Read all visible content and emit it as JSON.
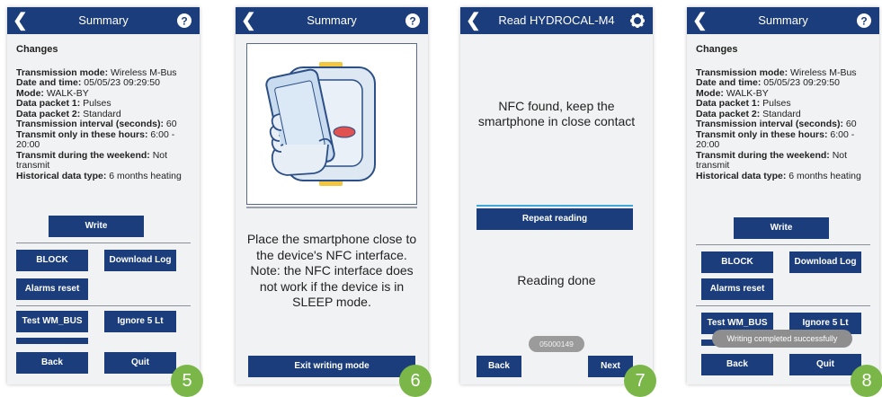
{
  "screens": [
    {
      "title": "Summary",
      "changes_heading": "Changes",
      "fields": [
        {
          "label": "Transmission mode:",
          "value": " Wireless M-Bus"
        },
        {
          "label": "Date and time:",
          "value": " 05/05/23 09:29:50"
        },
        {
          "label": "Mode:",
          "value": " WALK-BY"
        },
        {
          "label": "Data packet 1:",
          "value": " Pulses"
        },
        {
          "label": "Data packet 2:",
          "value": " Standard"
        },
        {
          "label": "Transmission interval (seconds):",
          "value": " 60"
        },
        {
          "label": "Transmit only in these hours:",
          "value": " 6:00 - 20:00"
        },
        {
          "label": "Transmit during the weekend:",
          "value": " Not transmit"
        },
        {
          "label": "Historical data type:",
          "value": " 6 months heating"
        }
      ],
      "write_label": "Write",
      "block_label": "BLOCK",
      "download_log_label": "Download Log",
      "alarms_reset_label": "Alarms reset",
      "test_wm_bus_label": "Test WM_BUS",
      "ignore_label": "Ignore 5 Lt",
      "back_label": "Back",
      "quit_label": "Quit",
      "step": "5"
    },
    {
      "title": "Summary",
      "instruction": "Place the smartphone close to the device's NFC interface. Note: the NFC interface does not work if the device is in SLEEP mode.",
      "exit_label": "Exit writing mode",
      "step": "6"
    },
    {
      "title": "Read HYDROCAL-M4",
      "nfc_message": "NFC found, keep the smartphone in close contact",
      "repeat_label": "Repeat reading",
      "reading_done": "Reading done",
      "serial": "05000149",
      "back_label": "Back",
      "next_label": "Next",
      "step": "7"
    },
    {
      "title": "Summary",
      "changes_heading": "Changes",
      "fields": [
        {
          "label": "Transmission mode:",
          "value": " Wireless M-Bus"
        },
        {
          "label": "Date and time:",
          "value": " 05/05/23 09:29:50"
        },
        {
          "label": "Mode:",
          "value": " WALK-BY"
        },
        {
          "label": "Data packet 1:",
          "value": " Pulses"
        },
        {
          "label": "Data packet 2:",
          "value": " Standard"
        },
        {
          "label": "Transmission interval (seconds):",
          "value": " 60"
        },
        {
          "label": "Transmit only in these hours:",
          "value": " 6:00 - 20:00"
        },
        {
          "label": "Transmit during the weekend:",
          "value": " Not transmit"
        },
        {
          "label": "Historical data type:",
          "value": " 6 months heating"
        }
      ],
      "write_label": "Write",
      "block_label": "BLOCK",
      "download_log_label": "Download Log",
      "alarms_reset_label": "Alarms reset",
      "test_wm_bus_label": "Test WM_BUS",
      "ignore_label": "Ignore 5 Lt",
      "back_label": "Back",
      "quit_label": "Quit",
      "toast": "Writing completed successfully",
      "step": "8"
    }
  ],
  "colors": {
    "bar": "#1b3d7c",
    "step": "#7ab648",
    "background": "#f1f2f4"
  },
  "icons": [
    "back-arrow-icon",
    "help-icon",
    "gear-icon",
    "phone-nfc-illustration"
  ]
}
